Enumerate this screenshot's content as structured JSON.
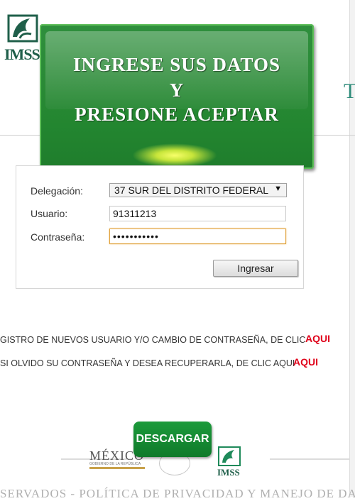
{
  "header": {
    "logo_text": "IMSS",
    "edge_letter": "T"
  },
  "banner": {
    "line1": "INGRESE  SUS DATOS",
    "line2": "Y",
    "line3": "PRESIONE ACEPTAR"
  },
  "login": {
    "delegacion_label": "Delegación:",
    "delegacion_value": "37 SUR DEL DISTRITO FEDERAL",
    "usuario_label": "Usuario:",
    "usuario_value": "91311213",
    "password_label": "Contraseña:",
    "password_value": "•••••••••••",
    "submit_label": "Ingresar"
  },
  "links": {
    "registro_text": "GISTRO DE NUEVOS USUARIO Y/O CAMBIO DE CONTRASEÑA, DE CLIC",
    "registro_link": "AQUI",
    "olvido_text": "SI OLVIDO SU CONTRASEÑA Y DESEA RECUPERARLA, DE CLIC AQUI",
    "olvido_link": "AQUI"
  },
  "footer": {
    "download_label": "DESCARGAR",
    "mexico_word": "MÉXICO",
    "mexico_sub": "GOBIERNO DE LA REPÚBLICA",
    "imss_text": "IMSS",
    "bottom_text": "SERVADOS - POLÍTICA DE PRIVACIDAD Y MANEJO DE DA"
  },
  "colors": {
    "banner_green": "#238630",
    "link_red": "#e0001a",
    "focus_orange": "#e0a23c",
    "imss_green": "#1f5f4a"
  }
}
